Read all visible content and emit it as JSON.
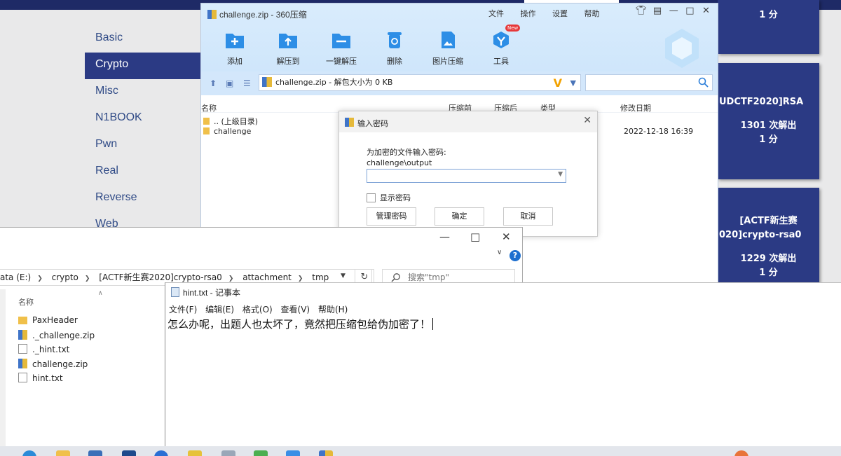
{
  "website": {
    "nav": [
      {
        "label": "Basic",
        "active": false
      },
      {
        "label": "Crypto",
        "active": true
      },
      {
        "label": "Misc",
        "active": false
      },
      {
        "label": "N1BOOK",
        "active": false
      },
      {
        "label": "Pwn",
        "active": false
      },
      {
        "label": "Real",
        "active": false
      },
      {
        "label": "Reverse",
        "active": false
      },
      {
        "label": "Web",
        "active": false
      }
    ],
    "cards": [
      {
        "title": "",
        "solves": "",
        "points": "1 分"
      },
      {
        "title": "UDCTF2020]RSA",
        "solves": "1301 次解出",
        "points": "1 分"
      },
      {
        "title_line1": "[ACTF新生赛",
        "title_line2": "020]crypto-rsa0",
        "solves": "1229 次解出",
        "points": "1 分"
      }
    ]
  },
  "zip_window": {
    "title": "challenge.zip - 360压缩",
    "menu": [
      "文件",
      "操作",
      "设置",
      "帮助"
    ],
    "toolbar": [
      {
        "label": "添加",
        "icon": "add-icon"
      },
      {
        "label": "解压到",
        "icon": "extract-to-icon"
      },
      {
        "label": "一键解压",
        "icon": "one-click-extract-icon"
      },
      {
        "label": "删除",
        "icon": "delete-icon"
      },
      {
        "label": "图片压缩",
        "icon": "image-compress-icon"
      },
      {
        "label": "工具",
        "icon": "tools-icon",
        "badge": "New"
      }
    ],
    "address": "challenge.zip - 解包大小为 0 KB",
    "columns": [
      "名称",
      "压缩前",
      "压缩后",
      "类型",
      "修改日期"
    ],
    "rows": [
      {
        "name": ".. (上级目录)"
      },
      {
        "name": "challenge",
        "date": "2022-12-18 16:39"
      }
    ]
  },
  "password_dialog": {
    "title": "输入密码",
    "prompt": "为加密的文件输入密码:",
    "path": "challenge\\output",
    "show_password": "显示密码",
    "buttons": {
      "manage": "管理密码",
      "ok": "确定",
      "cancel": "取消"
    }
  },
  "explorer": {
    "breadcrumb": [
      "ata (E:)",
      "crypto",
      "[ACTF新生赛2020]crypto-rsa0",
      "attachment",
      "tmp"
    ],
    "search_placeholder": "搜索\"tmp\"",
    "column_name": "名称",
    "files": [
      {
        "name": "PaxHeader",
        "type": "folder"
      },
      {
        "name": "._challenge.zip",
        "type": "zip"
      },
      {
        "name": "._hint.txt",
        "type": "txt"
      },
      {
        "name": "challenge.zip",
        "type": "zip"
      },
      {
        "name": "hint.txt",
        "type": "txt"
      }
    ]
  },
  "notepad": {
    "title": "hint.txt - 记事本",
    "menu": [
      "文件(F)",
      "编辑(E)",
      "格式(O)",
      "查看(V)",
      "帮助(H)"
    ],
    "content": "怎么办呢，出题人也太坏了，竟然把压缩包给伪加密了！"
  },
  "colors": {
    "nav_active_bg": "#2b3a84",
    "nav_text": "#2f4a86",
    "card_bg": "#2b3a84",
    "zip_header_bg": "#d9ecfc",
    "explorer_help": "#1e6fcf"
  }
}
